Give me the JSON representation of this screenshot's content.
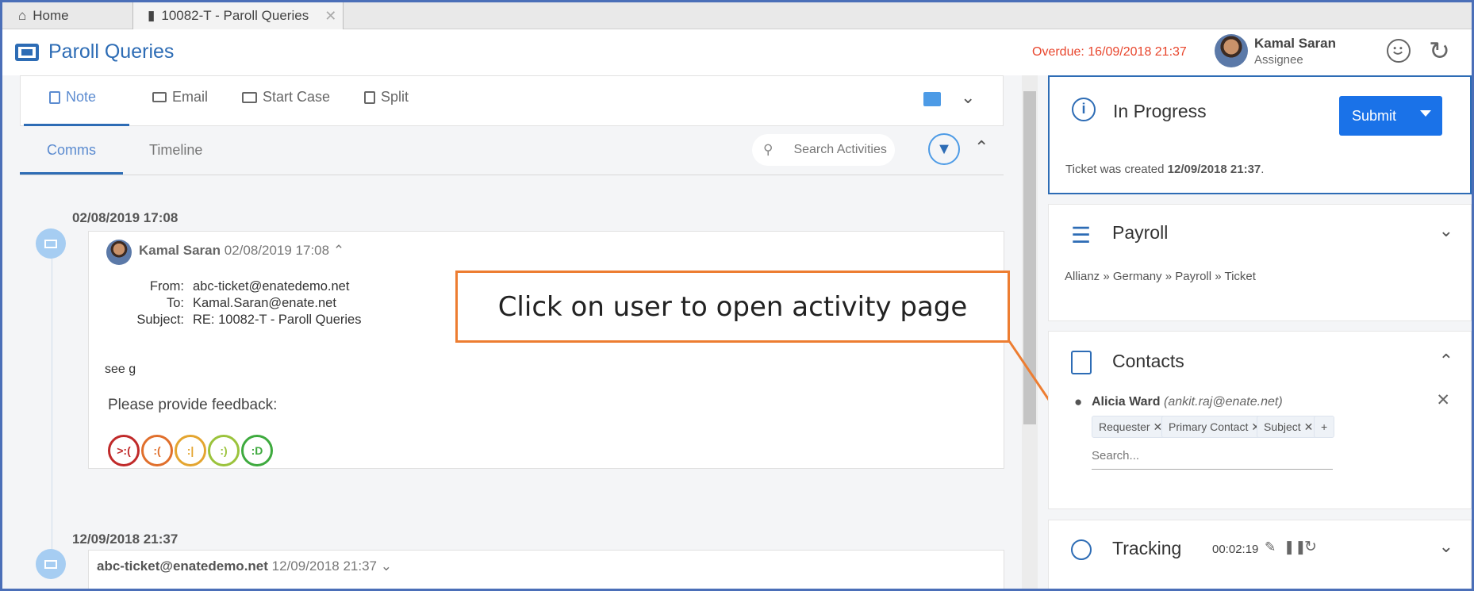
{
  "tabs": [
    {
      "label": "Home"
    },
    {
      "label": "10082-T - Paroll Queries"
    }
  ],
  "header": {
    "title": "Paroll Queries",
    "overdue": "Overdue: 16/09/2018 21:37",
    "user_name": "Kamal Saran",
    "user_role": "Assignee"
  },
  "actions": {
    "note": "Note",
    "email": "Email",
    "start_case": "Start Case",
    "split": "Split"
  },
  "subtabs": {
    "comms": "Comms",
    "timeline": "Timeline",
    "search_placeholder": "Search Activities"
  },
  "activities": [
    {
      "date": "02/08/2019 17:08",
      "author": "Kamal Saran",
      "timestamp": "02/08/2019 17:08",
      "from_label": "From:",
      "from": "abc-ticket@enatedemo.net",
      "to_label": "To:",
      "to": "Kamal.Saran@enate.net",
      "subject_label": "Subject:",
      "subject": "RE: 10082-T - Paroll Queries",
      "body": "see g",
      "feedback_prompt": "Please provide feedback:"
    },
    {
      "date": "12/09/2018 21:37",
      "author": "abc-ticket@enatedemo.net",
      "timestamp": "12/09/2018 21:37"
    }
  ],
  "callout": "Click on user to open activity page",
  "status": {
    "title": "In Progress",
    "submit_label": "Submit",
    "created_prefix": "Ticket was created ",
    "created_date": "12/09/2018 21:37",
    "created_suffix": "."
  },
  "payroll": {
    "title": "Payroll",
    "breadcrumb": "Allianz » Germany » Payroll » Ticket"
  },
  "contacts": {
    "title": "Contacts",
    "name": "Alicia Ward",
    "email": "(ankit.raj@enate.net)",
    "chips": [
      "Requester",
      "Primary Contact",
      "Subject"
    ],
    "search_placeholder": "Search..."
  },
  "tracking": {
    "title": "Tracking",
    "time": "00:02:19"
  },
  "colors": {
    "accent": "#2d6cb5",
    "overdue": "#e8452c",
    "submit": "#1a72e8",
    "callout_border": "#ed7d31",
    "frame": "#4b6fb8"
  }
}
